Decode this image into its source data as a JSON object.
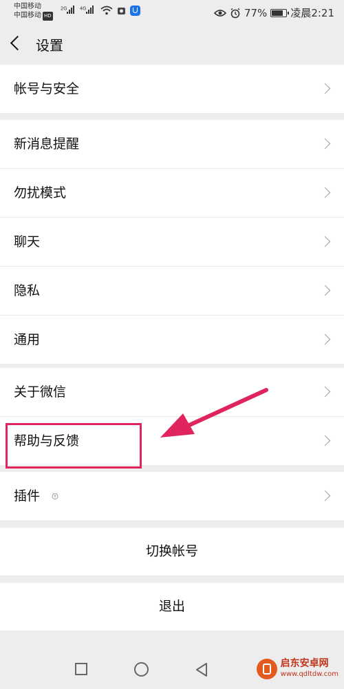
{
  "status_bar": {
    "carrier_1": "中国移动",
    "carrier_2": "中国移动",
    "hd_badge": "HD",
    "signal_1": "2G",
    "signal_2": "4G",
    "battery_percent": "77%",
    "time": "凌晨2:21",
    "icons": [
      "eye-icon",
      "alarm-icon",
      "wifi-icon",
      "battery-icon"
    ]
  },
  "header": {
    "title": "设置"
  },
  "groups": [
    {
      "items": [
        {
          "label": "帐号与安全"
        }
      ]
    },
    {
      "items": [
        {
          "label": "新消息提醒"
        },
        {
          "label": "勿扰模式"
        },
        {
          "label": "聊天"
        },
        {
          "label": "隐私"
        },
        {
          "label": "通用"
        }
      ]
    },
    {
      "items": [
        {
          "label": "关于微信"
        },
        {
          "label": "帮助与反馈"
        }
      ]
    },
    {
      "items": [
        {
          "label": "插件"
        }
      ]
    }
  ],
  "actions": {
    "switch_account": "切换帐号",
    "logout": "退出"
  },
  "annotation": {
    "highlight_color": "#e0245e",
    "highlighted_item": "帮助与反馈"
  },
  "watermark": {
    "name": "启东安卓网",
    "url": "www.qdltdw.com"
  },
  "colors": {
    "background": "#ededed",
    "row_background": "#ffffff",
    "accent_annotation": "#e0245e"
  }
}
